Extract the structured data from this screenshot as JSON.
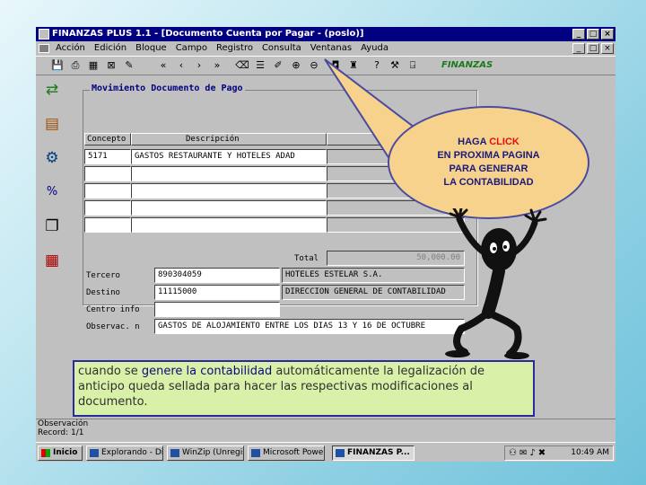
{
  "window": {
    "title": "FINANZAS PLUS 1.1 - [Documento Cuenta por Pagar - (poslo)]",
    "controls": [
      "_",
      "□",
      "×"
    ]
  },
  "menu": {
    "items": [
      "Acción",
      "Edición",
      "Bloque",
      "Campo",
      "Registro",
      "Consulta",
      "Ventanas",
      "Ayuda"
    ],
    "mdi_controls": [
      "_",
      "□",
      "×"
    ]
  },
  "toolbar": {
    "icons": [
      "save-icon",
      "print-icon",
      "grid-icon",
      "exit-icon",
      "edit-icon",
      "first-record-icon",
      "previous-record-icon",
      "next-record-icon",
      "last-record-icon",
      "clear-icon",
      "list-icon",
      "edit-field-icon",
      "insert-icon",
      "delete-icon",
      "lock-icon",
      "query-icon",
      "help-icon",
      "tools-icon",
      "door-icon"
    ],
    "logo_text": "FINANZAS"
  },
  "leftbar": {
    "icons": [
      "transfer-arrow-icon",
      "folder-building-icon",
      "user-tools-icon",
      "percent-icon",
      "cards-icon",
      "table-grid-icon"
    ]
  },
  "form": {
    "group_title": "Movimiento Documento de Pago",
    "columns": [
      "Concepto",
      "Descripción",
      ""
    ],
    "rows": [
      [
        "5171",
        "GASTOS RESTAURANTE Y HOTELES ADAD",
        ""
      ],
      [
        "",
        "",
        ""
      ],
      [
        "",
        "",
        ""
      ],
      [
        "",
        "",
        ""
      ],
      [
        "",
        "",
        ""
      ]
    ],
    "total_label": "Total",
    "total_value": "50,000.00",
    "tercero_label": "Tercero",
    "tercero_id": "890304059",
    "tercero_name": "HOTELES ESTELAR S.A.",
    "destino_label": "Destino",
    "destino_id": "11115000",
    "destino_name": "DIRECCION GENERAL DE CONTABILIDAD",
    "centro_label": "Centro info",
    "centro_value": "",
    "obs_label": "Observac. n",
    "obs_value": "GASTOS DE ALOJAMIENTO ENTRE LOS DIAS 13 Y 16 DE OCTUBRE"
  },
  "status": {
    "line1": "Observación",
    "line2": "Record: 1/1"
  },
  "taskbar": {
    "start_label": "Inicio",
    "tasks": [
      "Explorando - Dis...",
      "WinZip (Unregist...",
      "Microsoft Power...",
      "FINANZAS P..."
    ],
    "clock": "10:49 AM"
  },
  "callout": {
    "line1a": "HAGA ",
    "line1b": "CLICK",
    "line2": "EN PROXIMA PAGINA",
    "line3": "PARA GENERAR",
    "line4": "LA CONTABILIDAD"
  },
  "note": {
    "part1": "cuando se ",
    "highlight": "genere la contabilidad",
    "part2": " automáticamente la legalización de anticipo queda sellada para hacer las respectivas modificaciones al documento."
  }
}
